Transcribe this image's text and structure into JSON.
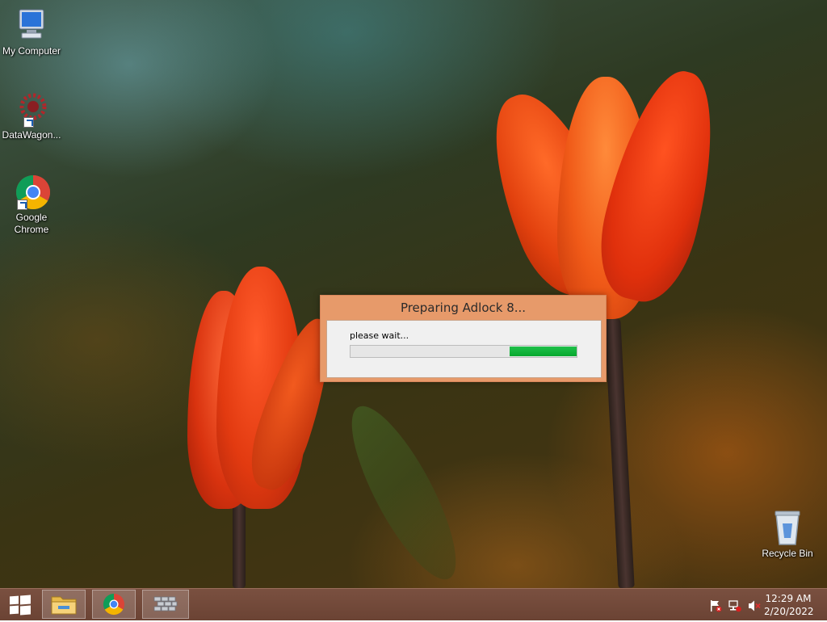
{
  "desktop": {
    "icons": [
      {
        "label": "My Computer",
        "icon": "computer-icon"
      },
      {
        "label": "DataWagon...",
        "icon": "datawagon-icon"
      },
      {
        "label": "Google Chrome",
        "icon": "chrome-icon"
      },
      {
        "label": "Recycle Bin",
        "icon": "recycle-bin-icon"
      }
    ]
  },
  "dialog": {
    "title": "Preparing Adlock 8...",
    "message": "please wait...",
    "progress_indeterminate": true,
    "progress_chunk_color": "#0fb33c"
  },
  "taskbar": {
    "pinned": [
      {
        "name": "file-explorer",
        "icon": "folder-icon"
      },
      {
        "name": "google-chrome",
        "icon": "chrome-icon"
      },
      {
        "name": "firewall",
        "icon": "brick-wall-icon"
      }
    ],
    "tray_icons": [
      "action-center-flag-icon",
      "network-icon",
      "volume-muted-icon"
    ],
    "clock": {
      "time": "12:29 AM",
      "date": "2/20/2022"
    }
  },
  "colors": {
    "taskbar": "#6b4334",
    "dialog_frame": "#e79a6a"
  }
}
